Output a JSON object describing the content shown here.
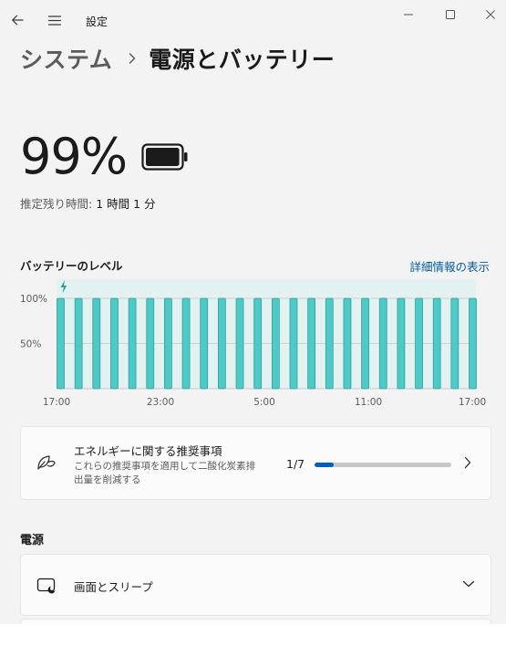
{
  "app": {
    "title": "設定",
    "back_icon": "back-arrow-icon",
    "menu_icon": "hamburger-menu-icon",
    "window_controls": [
      "minimize-icon",
      "maximize-icon",
      "close-icon"
    ]
  },
  "breadcrumb": {
    "parent": "システム",
    "separator_icon": "chevron-right-icon",
    "current": "電源とバッテリー"
  },
  "battery": {
    "percent_text": "99%",
    "level": 0.99,
    "icon": "battery-full-icon",
    "remaining_label": "推定残り時間:",
    "remaining_value": "1 時間 1 分"
  },
  "chart_header": {
    "title": "バッテリーのレベル",
    "details_link": "詳細情報の表示"
  },
  "chart_data": {
    "type": "bar",
    "title": "バッテリーのレベル",
    "y_ticks": [
      "100%",
      "50%"
    ],
    "ylim": [
      0,
      100
    ],
    "x_tick_labels": [
      "17:00",
      "23:00",
      "5:00",
      "11:00",
      "17:00"
    ],
    "values": [
      100,
      100,
      100,
      100,
      100,
      100,
      100,
      100,
      100,
      100,
      100,
      100,
      100,
      100,
      100,
      100,
      100,
      100,
      100,
      100,
      100,
      100,
      100,
      100
    ],
    "charging_icon": "lightning-bolt-icon",
    "bar_color": "#4fc9c6",
    "bar_edge_color": "#2aa3a3",
    "charging_band_color": "#e3f1f0",
    "grid": true
  },
  "energy": {
    "icon": "leaf-recommendation-icon",
    "title": "エネルギーに関する推奨事項",
    "description_line1": "これらの推奨事項を適用して二酸化炭素排",
    "description_line2": "出量を削減する",
    "count": "1/7",
    "progress": 0.143,
    "chevron_icon": "chevron-right-icon"
  },
  "power_section": {
    "title": "電源",
    "items": [
      {
        "icon": "screen-sleep-icon",
        "label": "画面とスリープ",
        "chevron_icon": "chevron-down-icon"
      }
    ]
  },
  "colors": {
    "accent": "#005fb8",
    "link": "#005a9e",
    "background": "#f3f3f3",
    "card": "#fbfbfb"
  }
}
